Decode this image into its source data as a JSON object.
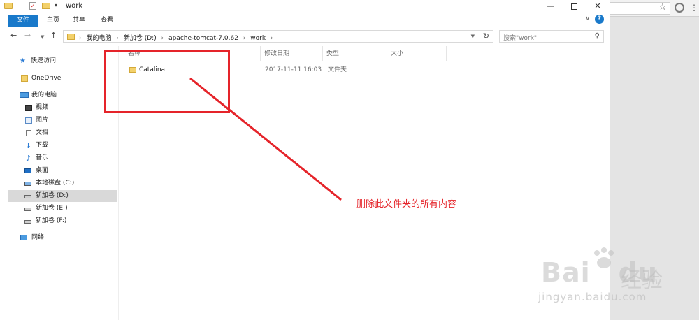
{
  "window": {
    "title": "work",
    "quick_access_dropdown": "▾"
  },
  "ribbon": {
    "tabs": [
      "文件",
      "主页",
      "共享",
      "查看"
    ],
    "help": "?"
  },
  "navbar": {
    "back": "←",
    "forward": "→",
    "recent": "▼",
    "up": "↑",
    "breadcrumbs": [
      "我的电脑",
      "新加卷 (D:)",
      "apache-tomcat-7.0.62",
      "work"
    ],
    "crumb_separator": "›",
    "refresh": "↻",
    "search_placeholder": "搜索\"work\""
  },
  "sidebar": {
    "items": [
      {
        "label": "快速访问",
        "icon": "star-icon"
      },
      {
        "label": "OneDrive",
        "icon": "folder-icon"
      },
      {
        "label": "我的电脑",
        "icon": "computer-icon"
      },
      {
        "label": "视频",
        "icon": "video-icon"
      },
      {
        "label": "图片",
        "icon": "picture-icon"
      },
      {
        "label": "文档",
        "icon": "document-icon"
      },
      {
        "label": "下载",
        "icon": "download-icon"
      },
      {
        "label": "音乐",
        "icon": "music-icon"
      },
      {
        "label": "桌面",
        "icon": "desktop-icon"
      },
      {
        "label": "本地磁盘 (C:)",
        "icon": "drive-c-icon"
      },
      {
        "label": "新加卷 (D:)",
        "icon": "drive-d-icon",
        "selected": true
      },
      {
        "label": "新加卷 (E:)",
        "icon": "drive-e-icon"
      },
      {
        "label": "新加卷 (F:)",
        "icon": "drive-f-icon"
      },
      {
        "label": "网络",
        "icon": "network-icon"
      }
    ]
  },
  "columns": [
    "名称",
    "修改日期",
    "类型",
    "大小"
  ],
  "files": [
    {
      "name": "Catalina",
      "date": "2017-11-11 16:03",
      "type": "文件夹",
      "size": ""
    }
  ],
  "annotation": {
    "text": "删除此文件夹的所有内容",
    "color": "#e5242a"
  },
  "watermark": {
    "brand": "Bai",
    "brand_tail": "du",
    "product": "经验",
    "url": "jingyan.baidu.com"
  },
  "colors": {
    "accent": "#1979ca",
    "selection": "#d9d9d9",
    "folder": "#f3d16b"
  }
}
